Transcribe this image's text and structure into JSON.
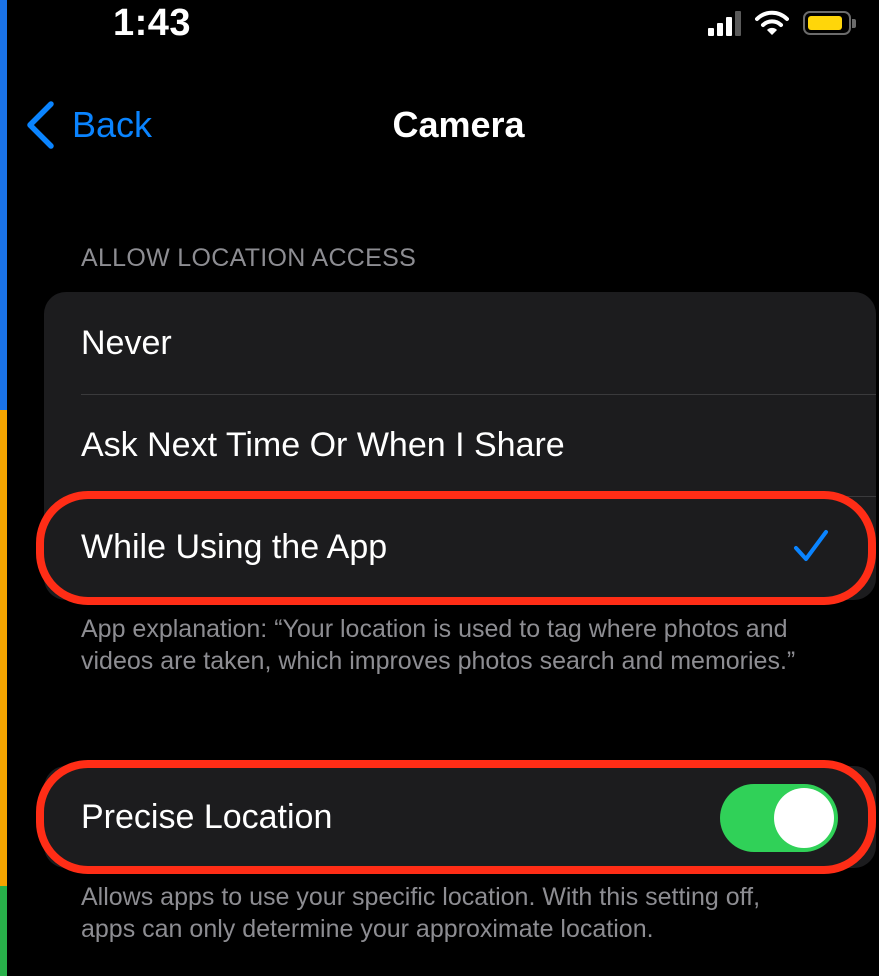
{
  "colors": {
    "accent": "#0a84ff",
    "toggle_on": "#30d158",
    "battery": "#ffd60a",
    "highlight": "#ff2d16"
  },
  "status_bar": {
    "time": "1:43",
    "icons": [
      "cellular-signal-icon",
      "wifi-icon",
      "battery-icon"
    ]
  },
  "nav": {
    "back_label": "Back",
    "title": "Camera"
  },
  "location_access": {
    "header": "ALLOW LOCATION ACCESS",
    "options": [
      {
        "label": "Never",
        "selected": false
      },
      {
        "label": "Ask Next Time Or When I Share",
        "selected": false
      },
      {
        "label": "While Using the App",
        "selected": true
      }
    ],
    "footer": "App explanation: “Your location is used to tag where photos and videos are taken, which improves photos search and memories.”"
  },
  "precise_location": {
    "label": "Precise Location",
    "enabled": true,
    "footer": "Allows apps to use your specific location. With this setting off, apps can only determine your approximate location."
  }
}
